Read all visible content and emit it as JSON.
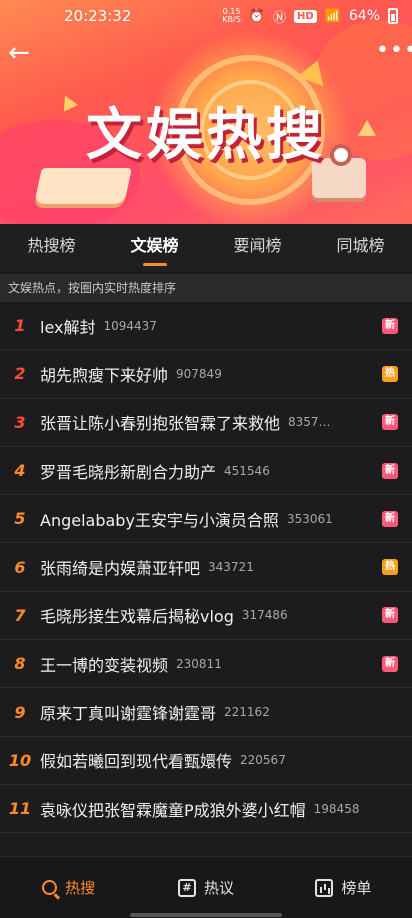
{
  "status_bar": {
    "time": "20:23:32",
    "speed_value": "0.15",
    "speed_unit": "KB/S",
    "hd": "HD",
    "network": "4G",
    "battery": "64%"
  },
  "banner": {
    "title": "文娱热搜"
  },
  "tabs": [
    {
      "label": "热搜榜"
    },
    {
      "label": "文娱榜"
    },
    {
      "label": "要闻榜"
    },
    {
      "label": "同城榜"
    }
  ],
  "subtitle": "文娱热点，按圈内实时热度排序",
  "list": [
    {
      "rank": "1",
      "title": "lex解封",
      "count": "1094437",
      "badge": "新"
    },
    {
      "rank": "2",
      "title": "胡先煦瘦下来好帅",
      "count": "907849",
      "badge": "热"
    },
    {
      "rank": "3",
      "title": "张晋让陈小春别抱张智霖了来救他",
      "count": "8357…",
      "badge": "新"
    },
    {
      "rank": "4",
      "title": "罗晋毛晓彤新剧合力助产",
      "count": "451546",
      "badge": "新"
    },
    {
      "rank": "5",
      "title": "Angelababy王安宇与小演员合照",
      "count": "353061",
      "badge": "新"
    },
    {
      "rank": "6",
      "title": "张雨绮是内娱萧亚轩吧",
      "count": "343721",
      "badge": "热"
    },
    {
      "rank": "7",
      "title": "毛晓彤接生戏幕后揭秘vlog",
      "count": "317486",
      "badge": "新"
    },
    {
      "rank": "8",
      "title": "王一博的变装视频",
      "count": "230811",
      "badge": "新"
    },
    {
      "rank": "9",
      "title": "原来丁真叫谢霆锋谢霆哥",
      "count": "221162",
      "badge": ""
    },
    {
      "rank": "10",
      "title": "假如若曦回到现代看甄嬛传",
      "count": "220567",
      "badge": ""
    },
    {
      "rank": "11",
      "title": "袁咏仪把张智霖魔童P成狼外婆小红帽",
      "count": "198458",
      "badge": ""
    }
  ],
  "bottom_nav": [
    {
      "label": "热搜"
    },
    {
      "label": "热议"
    },
    {
      "label": "榜单"
    }
  ]
}
